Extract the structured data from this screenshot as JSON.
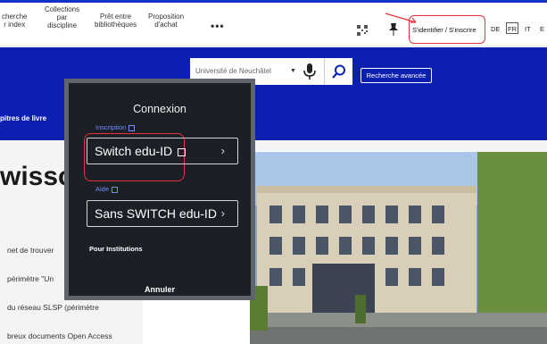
{
  "nav": {
    "items": [
      {
        "lines": [
          "cherche",
          "r index"
        ]
      },
      {
        "lines": [
          "Collections",
          "par",
          "discipline"
        ]
      },
      {
        "lines": [
          "Prêt entre",
          "bibliothèques"
        ]
      },
      {
        "lines": [
          "Proposition",
          "d'achat"
        ]
      }
    ],
    "more": "•••",
    "login": "S'identifier / S'inscrire",
    "languages": [
      "DE",
      "FR",
      "IT",
      "E"
    ]
  },
  "search": {
    "scope": "Université de Neuchâtel",
    "caret": "▼",
    "advanced": "Recherche avancée"
  },
  "subnav": {
    "left_text": "pitres de livre"
  },
  "main": {
    "title": "wissc",
    "lines": [
      "net de trouver",
      "périmètre \"Un",
      "du réseau SLSP (périmètre",
      "breux documents Open Access"
    ]
  },
  "modal": {
    "title": "Connexion",
    "register_link": "Inscription",
    "option1": "Switch edu-ID",
    "help_link": "Aide",
    "option2": "Sans SWITCH edu-ID",
    "institutions": "Pour Institutions",
    "cancel": "Annuler",
    "chevron": "›"
  },
  "colors": {
    "brand_blue": "#0b20b0",
    "modal_bg": "#1c1f26",
    "link_blue": "#6f8cff",
    "highlight_red": "#e8323c"
  }
}
